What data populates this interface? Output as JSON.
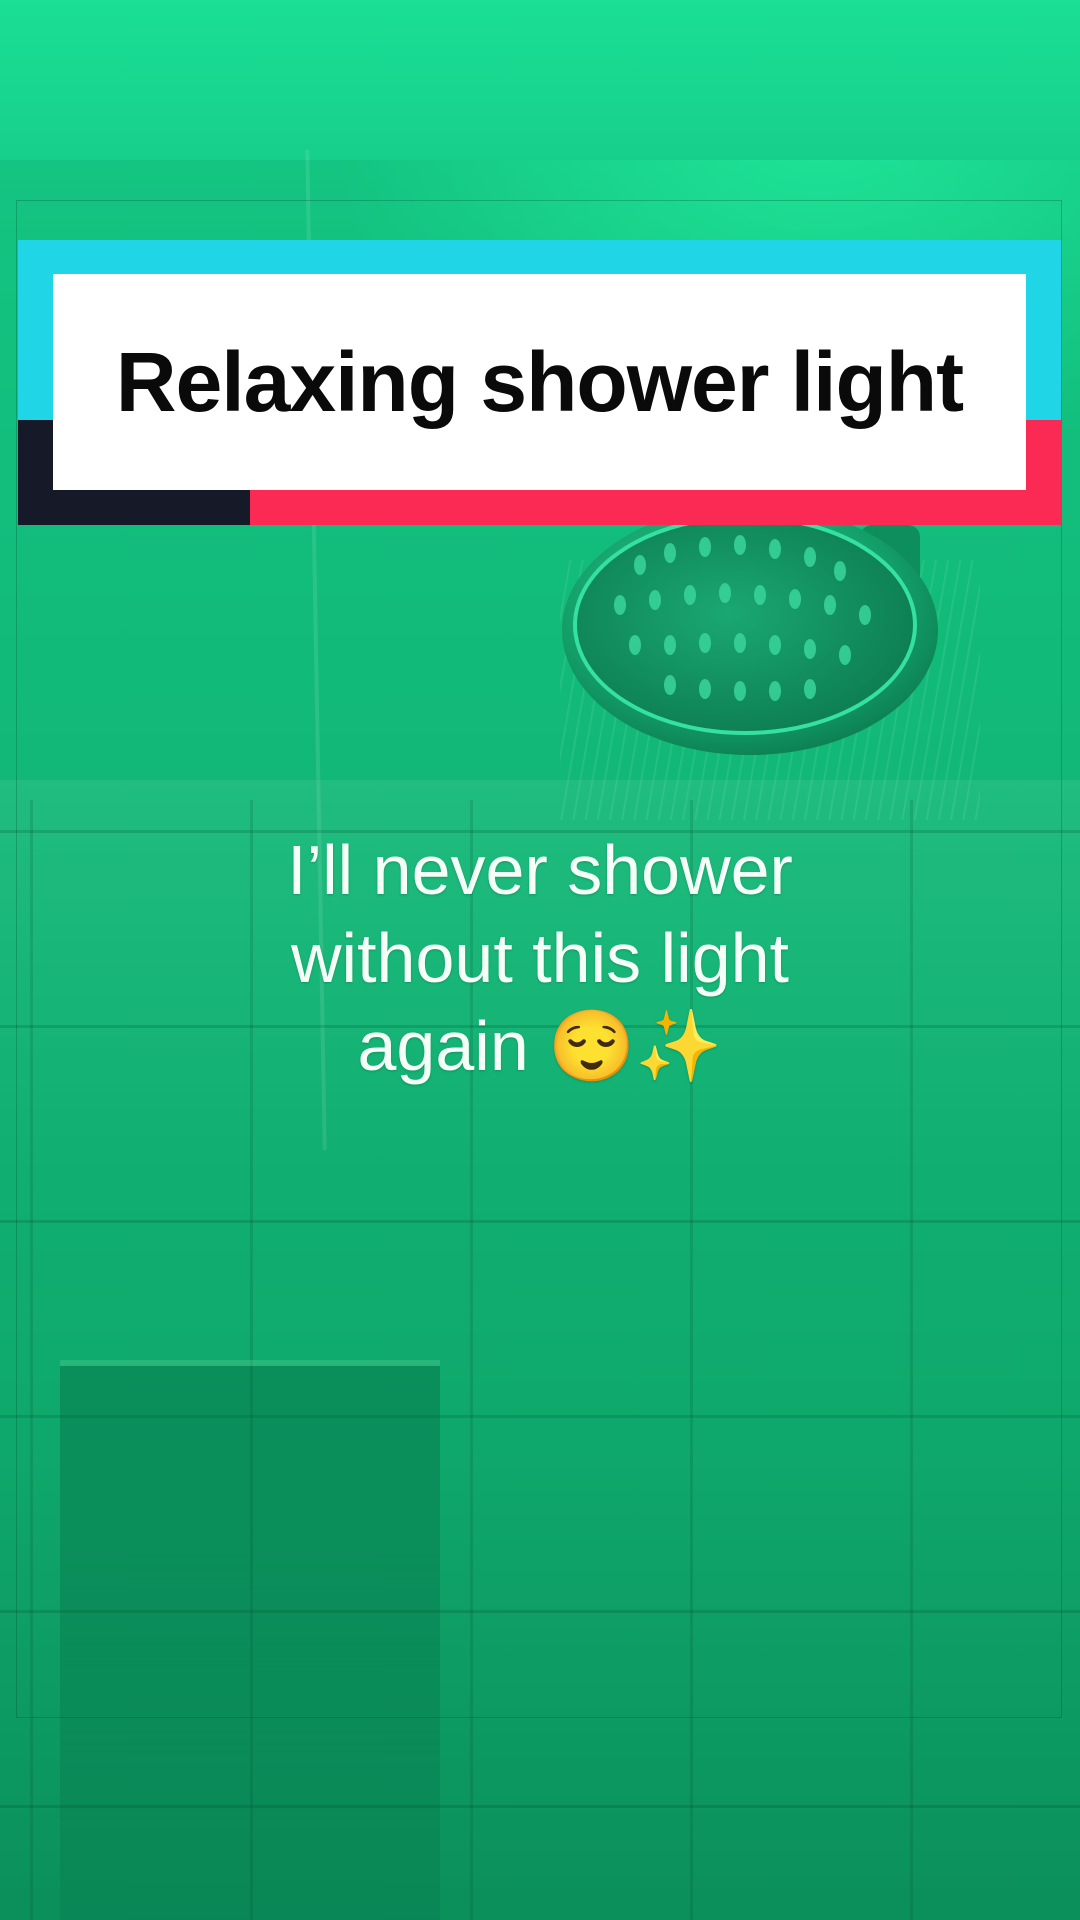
{
  "banner": {
    "title": "Relaxing shower light",
    "colors": {
      "cyan": "#20d5e6",
      "red": "#fb2a55",
      "dark": "#161a28",
      "panel": "#ffffff"
    }
  },
  "caption": {
    "lines": [
      "I’ll never shower",
      "without this light",
      "again 😌✨"
    ],
    "color": "#f4fff8"
  },
  "scene": {
    "description_color": "#12b878",
    "objects": [
      "shower-head",
      "wall-tiles",
      "shower-bench"
    ]
  }
}
